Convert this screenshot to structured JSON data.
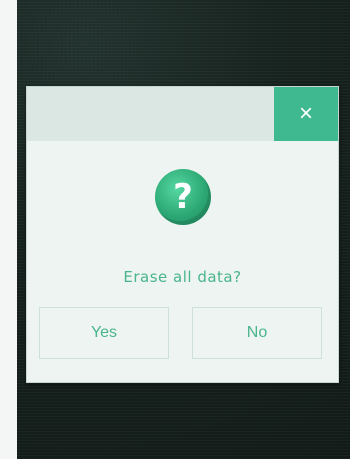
{
  "dialog": {
    "close_glyph": "×",
    "icon_glyph": "?",
    "message": "Erase all data?",
    "yes_label": "Yes",
    "no_label": "No"
  },
  "icons": {
    "close": "close-icon",
    "question": "question-icon"
  },
  "colors": {
    "accent": "#3fb98f",
    "text_accent": "#49b58d",
    "dialog_bg": "#eef4f1",
    "titlebar_bg": "#dbe7e2"
  }
}
